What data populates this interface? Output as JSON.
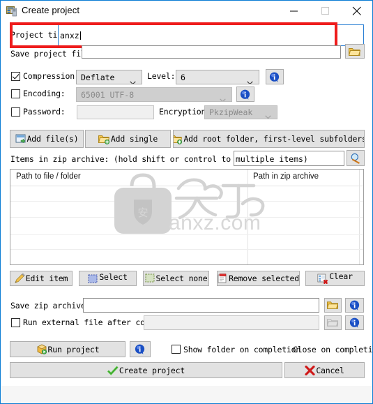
{
  "window": {
    "title": "Create project",
    "icon": "app-window-icon",
    "controls": {
      "minimize": "minimize-icon",
      "maximize": "maximize-icon",
      "close": "close-icon"
    }
  },
  "project": {
    "title_label": "Project tit",
    "title_value": "anxz",
    "save_label": "Save project file to:",
    "save_value": "",
    "browse_icon": "folder-open-icon"
  },
  "compression": {
    "checkbox_label": "Compression:",
    "checked": true,
    "method": "Deflate",
    "level_label": "Level:",
    "level": "6",
    "info_icon": "info-icon"
  },
  "encoding": {
    "checkbox_label": "Encoding:",
    "checked": false,
    "value": "65001 UTF-8",
    "info_icon": "info-icon"
  },
  "password": {
    "checkbox_label": "Password:",
    "checked": false,
    "value": "",
    "encryption_label": "Encryption:",
    "encryption_value": "PkzipWeak"
  },
  "add_buttons": [
    {
      "label": "Add file(s)",
      "icon": "add-file-icon"
    },
    {
      "label": "Add single",
      "icon": "add-folder-icon"
    },
    {
      "label": "Add root folder, first-level subfolders",
      "icon": "add-folder-icon"
    }
  ],
  "items": {
    "label": "Items in zip archive: (hold shift or control to select",
    "search_value": "multiple items)",
    "search_icon": "search-icon",
    "columns": [
      "Path to file / folder",
      "Path in zip archive"
    ],
    "rows": []
  },
  "watermark": {
    "logo": "anxz-shield-logo",
    "text": "anxz.com"
  },
  "item_buttons": [
    {
      "label": "Edit item",
      "icon": "pencil-icon"
    },
    {
      "label": "Select",
      "icon": "select-all-icon"
    },
    {
      "label": "Select none",
      "icon": "select-none-icon"
    },
    {
      "label": "Remove selected",
      "icon": "remove-icon"
    },
    {
      "label": "Clear",
      "icon": "clear-icon"
    }
  ],
  "save_zip": {
    "label": "Save zip archive to:",
    "value": "",
    "browse_icon": "folder-open-icon",
    "info_icon": "info-icon"
  },
  "run_external": {
    "checkbox_label": "Run external file after completion:",
    "checked": false,
    "value": "",
    "browse_icon": "folder-open-icon",
    "info_icon": "info-icon"
  },
  "footer": {
    "run_project_label": "Run project",
    "run_project_icon": "package-run-icon",
    "run_info_icon": "info-icon",
    "show_folder_label": "Show folder on completion",
    "show_folder_checked": false,
    "close_on_completion_label": "Close on completion",
    "create_label": "Create project",
    "create_icon": "green-check-icon",
    "cancel_label": "Cancel",
    "cancel_icon": "red-x-icon"
  },
  "colors": {
    "window_border": "#0a7cd4",
    "annotation": "#ee1c1c",
    "focus_border": "#2a7fd4",
    "button_face": "#e2e2e2"
  }
}
